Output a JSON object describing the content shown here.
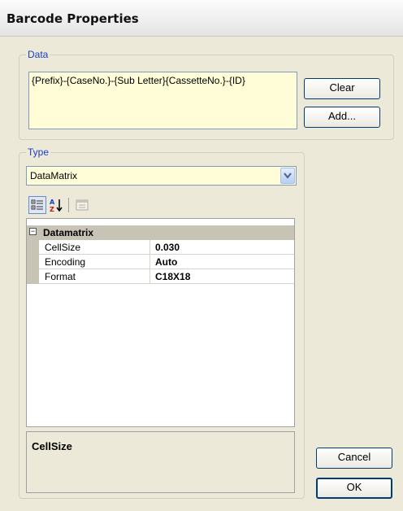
{
  "window": {
    "title": "Barcode Properties"
  },
  "data_group": {
    "label": "Data",
    "value": "{Prefix}-{CaseNo.}-{Sub Letter}{CassetteNo.}-{ID}",
    "clear_label": "Clear",
    "add_label": "Add..."
  },
  "type_group": {
    "label": "Type",
    "selected": "DataMatrix"
  },
  "toolbar": {
    "icons": [
      "categorized-icon",
      "alphabetical-icon",
      "property-pages-icon"
    ]
  },
  "grid": {
    "category": "Datamatrix",
    "rows": [
      {
        "name": "CellSize",
        "value": "0.030"
      },
      {
        "name": "Encoding",
        "value": "Auto"
      },
      {
        "name": "Format",
        "value": "C18X18"
      }
    ]
  },
  "description": {
    "title": "CellSize"
  },
  "buttons": {
    "cancel_label": "Cancel",
    "ok_label": "OK"
  },
  "colors": {
    "group_label": "#1a3ec9",
    "input_bg": "#fffdd8",
    "dialog_bg": "#ece9d8"
  }
}
